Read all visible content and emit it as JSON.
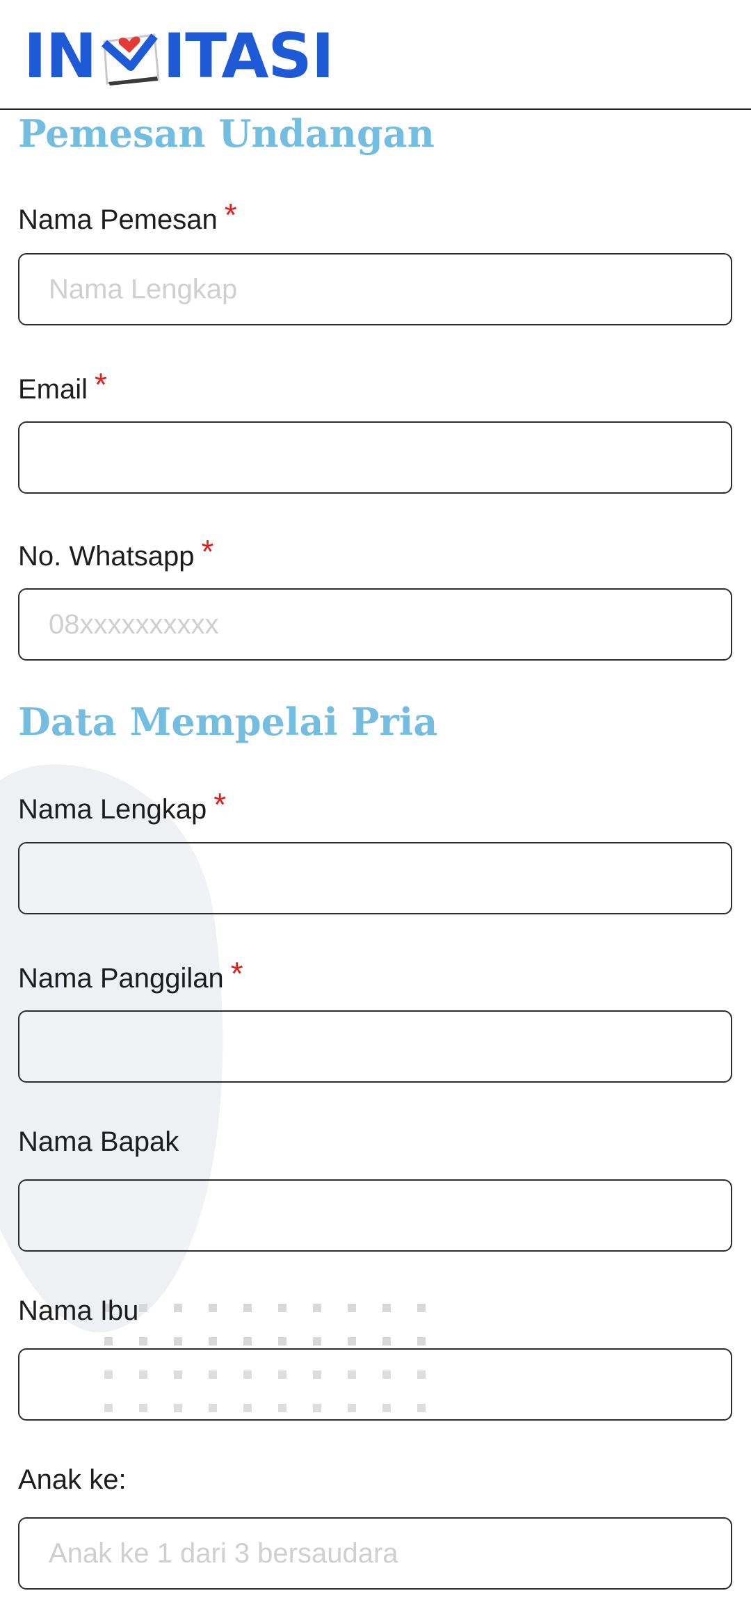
{
  "header": {
    "logo_left": "IN",
    "logo_right": "ITASI"
  },
  "sections": {
    "orderer": {
      "title": "Pemesan Undangan"
    },
    "groom": {
      "title": "Data Mempelai Pria"
    }
  },
  "fields": {
    "nama_pemesan": {
      "label": "Nama Pemesan",
      "required": "*",
      "placeholder": "Nama Lengkap",
      "value": ""
    },
    "email": {
      "label": "Email",
      "required": "*",
      "placeholder": "",
      "value": ""
    },
    "whatsapp": {
      "label": "No. Whatsapp",
      "required": "*",
      "placeholder": "08xxxxxxxxxx",
      "value": ""
    },
    "nama_lengkap": {
      "label": "Nama Lengkap",
      "required": "*",
      "placeholder": "",
      "value": ""
    },
    "nama_panggilan": {
      "label": "Nama Panggilan",
      "required": "*",
      "placeholder": "",
      "value": ""
    },
    "nama_bapak": {
      "label": "Nama Bapak",
      "placeholder": "",
      "value": ""
    },
    "nama_ibu": {
      "label": "Nama Ibu",
      "placeholder": "",
      "value": ""
    },
    "anak_ke": {
      "label": "Anak ke:",
      "placeholder": "Anak ke 1 dari 3 bersaudara",
      "value": ""
    }
  },
  "colors": {
    "section_title": "#72bde0",
    "required": "#e11d1d",
    "logo": "#1e5ad6",
    "logo_heart": "#e53935"
  }
}
